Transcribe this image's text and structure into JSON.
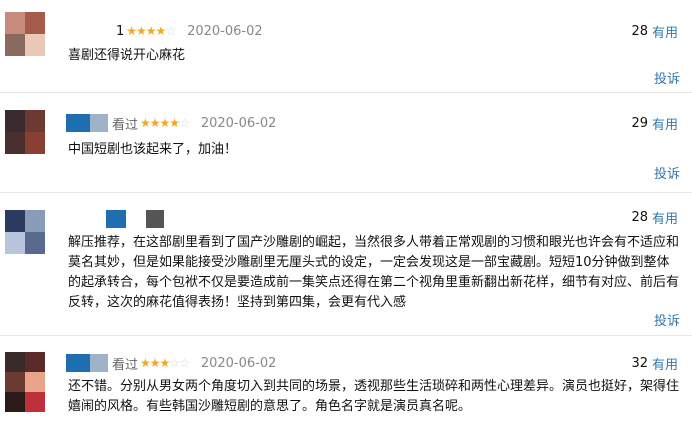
{
  "comments": [
    {
      "status": "",
      "lead": "1",
      "stars": "★★★★",
      "stars_off": "☆",
      "date": "2020-06-02",
      "votes": "28",
      "useful_label": "有用",
      "text": "喜剧还得说开心麻花",
      "report_label": "投诉"
    },
    {
      "status": "看过",
      "lead": "",
      "stars": "★★★★",
      "stars_off": "☆",
      "date": "2020-06-02",
      "votes": "29",
      "useful_label": "有用",
      "text": "中国短剧也该起来了，加油！",
      "report_label": "投诉"
    },
    {
      "status": "",
      "lead": "",
      "stars": "",
      "stars_off": "",
      "date": "",
      "votes": "28",
      "useful_label": "有用",
      "text_lines": [
        "解压推荐，在这部剧里看到了国产沙雕剧的崛起，当然很多人带着正常观剧的习惯和眼光也许会有不适应和",
        "莫名其妙，但是如果能接受沙雕剧里无厘头式的设定，一定会发现这是一部宝藏剧。短短10分钟做到整体",
        "的起承转合，每个包袱不仅是要造成前一集笑点还得在第二个视角里重新翻出新花样，细节有对应、前后有",
        "反转，这次的麻花值得表扬！坚持到第四集，会更有代入感"
      ],
      "report_label": "投诉"
    },
    {
      "status": "看过",
      "lead": "",
      "stars": "★★★",
      "stars_off": "☆☆",
      "date": "2020-06-02",
      "votes": "32",
      "useful_label": "有用",
      "text_lines": [
        "还不错。分别从男女两个角度切入到共同的场景，透视那些生活琐碎和两性心理差异。演员也挺好，架得住",
        "嬉闹的风格。有些韩国沙雕短剧的意思了。角色名字就是演员真名呢。"
      ]
    }
  ],
  "colors": {
    "link": "#3377aa",
    "star": "#f5a623"
  }
}
